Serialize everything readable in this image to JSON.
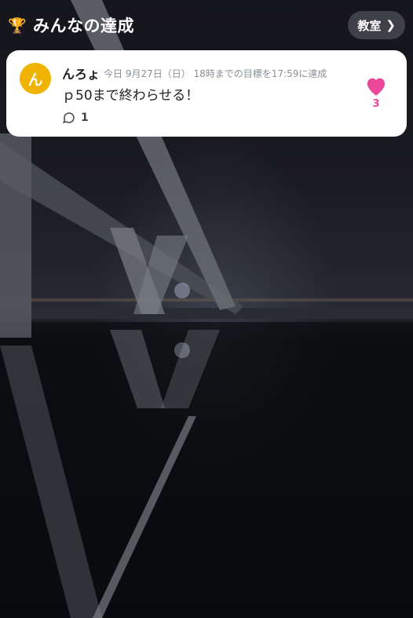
{
  "header": {
    "title": "みんなの達成",
    "trophy_icon": "trophy-icon",
    "class_button_label": "教室",
    "class_button_icon": "chevron-right-icon"
  },
  "post": {
    "avatar_initial": "ん",
    "avatar_color": "#f0b400",
    "user_name": "んろょ",
    "meta": "今日 9月27日（日） 18時までの目標を17:59に達成",
    "message": "ｐ50まで終わらせる！",
    "comment_count": "1",
    "like_count": "3",
    "like_color": "#ec4899"
  }
}
